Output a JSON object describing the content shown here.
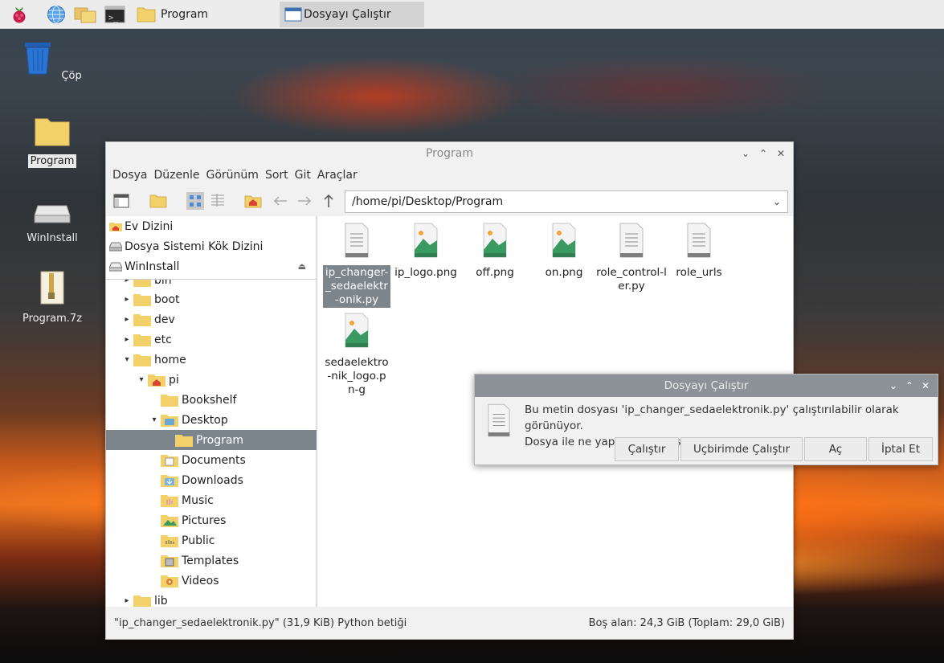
{
  "taskbar": {
    "items": [
      {
        "name": "raspberry-menu-icon"
      },
      {
        "name": "web-browser-icon"
      },
      {
        "name": "file-manager-icon"
      },
      {
        "name": "terminal-icon"
      }
    ],
    "tasks": [
      {
        "label": "Program",
        "icon": "folder-icon"
      },
      {
        "label": "Dosyayı Çalıştır",
        "icon": "window-icon"
      }
    ]
  },
  "desktop": {
    "icons": [
      {
        "label": "Çöp",
        "icon": "trash-icon"
      },
      {
        "label": "Program",
        "icon": "folder-icon"
      },
      {
        "label": "WinInstall",
        "icon": "drive-icon"
      },
      {
        "label": "Program.7z",
        "icon": "archive-icon"
      }
    ]
  },
  "window": {
    "title": "Program",
    "menu": [
      "Dosya",
      "Düzenle",
      "Görünüm",
      "Sort",
      "Git",
      "Araçlar"
    ],
    "path": "/home/pi/Desktop/Program",
    "places": [
      {
        "label": "Ev Dizini",
        "icon": "home-icon"
      },
      {
        "label": "Dosya Sistemi Kök Dizini",
        "icon": "drive-icon"
      },
      {
        "label": "WinInstall",
        "icon": "drive-icon"
      }
    ],
    "tree": [
      {
        "label": "bin",
        "arrow": "▸"
      },
      {
        "label": "boot",
        "arrow": "▸"
      },
      {
        "label": "dev",
        "arrow": "▸"
      },
      {
        "label": "etc",
        "arrow": "▸"
      },
      {
        "label": "home",
        "arrow": "▾"
      },
      {
        "label": "pi",
        "arrow": "▾"
      },
      {
        "label": "Bookshelf",
        "arrow": ""
      },
      {
        "label": "Desktop",
        "arrow": "▾"
      },
      {
        "label": "Program",
        "arrow": ""
      },
      {
        "label": "Documents",
        "arrow": ""
      },
      {
        "label": "Downloads",
        "arrow": ""
      },
      {
        "label": "Music",
        "arrow": ""
      },
      {
        "label": "Pictures",
        "arrow": ""
      },
      {
        "label": "Public",
        "arrow": ""
      },
      {
        "label": "Templates",
        "arrow": ""
      },
      {
        "label": "Videos",
        "arrow": ""
      },
      {
        "label": "lib",
        "arrow": "▸"
      }
    ],
    "files": [
      {
        "name": "ip_changer-_sedaelektr-onik.py",
        "type": "text"
      },
      {
        "name": "ip_logo.png",
        "type": "image"
      },
      {
        "name": "off.png",
        "type": "image"
      },
      {
        "name": "on.png",
        "type": "image"
      },
      {
        "name": "role_control-ler.py",
        "type": "text"
      },
      {
        "name": "role_urls",
        "type": "text"
      },
      {
        "name": "sedaelektro-nik_logo.pn-g",
        "type": "image"
      }
    ],
    "status_left": "\"ip_changer_sedaelektronik.py\" (31,9 KiB) Python betiği",
    "status_right": "Boş alan: 24,3 GiB (Toplam: 29,0 GiB)"
  },
  "dialog": {
    "title": "Dosyayı Çalıştır",
    "message_line1": "Bu metin dosyası 'ip_changer_sedaelektronik.py' çalıştırılabilir olarak görünüyor.",
    "message_line2": "Dosya ile ne yapmak istiyorsunuz?",
    "buttons": {
      "run": "Çalıştır",
      "run_terminal": "Uçbirimde Çalıştır",
      "open": "Aç",
      "cancel": "İptal Et"
    }
  }
}
